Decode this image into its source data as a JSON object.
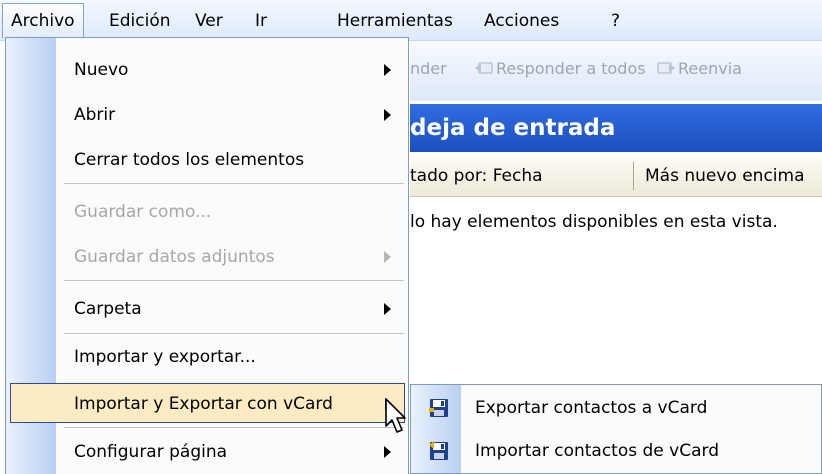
{
  "menubar": {
    "items": [
      {
        "label": "Archivo",
        "name": "menu-archivo"
      },
      {
        "label": "Edición",
        "name": "menu-edicion"
      },
      {
        "label": "Ver",
        "name": "menu-ver"
      },
      {
        "label": "Ir",
        "name": "menu-ir"
      },
      {
        "label": "Herramientas",
        "name": "menu-herramientas"
      },
      {
        "label": "Acciones",
        "name": "menu-acciones"
      },
      {
        "label": "?",
        "name": "menu-ayuda"
      }
    ]
  },
  "toolbar": {
    "responder": "nder",
    "responder_todos": "Responder a todos",
    "reenviar": "Reenvia"
  },
  "folder": {
    "title": "deja de entrada",
    "sort_by": "tado por: Fecha",
    "sort_order": "Más nuevo encima",
    "empty_message": "lo hay elementos disponibles en esta vista."
  },
  "file_menu": {
    "items": [
      {
        "label": "Nuevo",
        "submenu": true,
        "disabled": false
      },
      {
        "label": "Abrir",
        "submenu": true,
        "disabled": false
      },
      {
        "label": "Cerrar todos los elementos",
        "submenu": false,
        "disabled": false
      },
      {
        "label": "Guardar como...",
        "submenu": false,
        "disabled": true
      },
      {
        "label": "Guardar datos adjuntos",
        "submenu": true,
        "disabled": true
      },
      {
        "label": "Carpeta",
        "submenu": true,
        "disabled": false
      },
      {
        "label": "Importar y exportar...",
        "submenu": false,
        "disabled": false
      },
      {
        "label": "Importar y Exportar con vCard",
        "submenu": true,
        "disabled": false,
        "highlighted": true
      },
      {
        "label": "Configurar página",
        "submenu": true,
        "disabled": false
      }
    ]
  },
  "vcard_submenu": {
    "items": [
      {
        "label": "Exportar contactos a vCard",
        "icon": "floppy-export-icon"
      },
      {
        "label": "Importar contactos de vCard",
        "icon": "floppy-import-icon"
      }
    ]
  },
  "colors": {
    "highlight_bg": "#fdebc3",
    "highlight_border": "#2a48a8",
    "header_blue": "#2f6de1",
    "disabled_text": "#a7a7a7"
  }
}
